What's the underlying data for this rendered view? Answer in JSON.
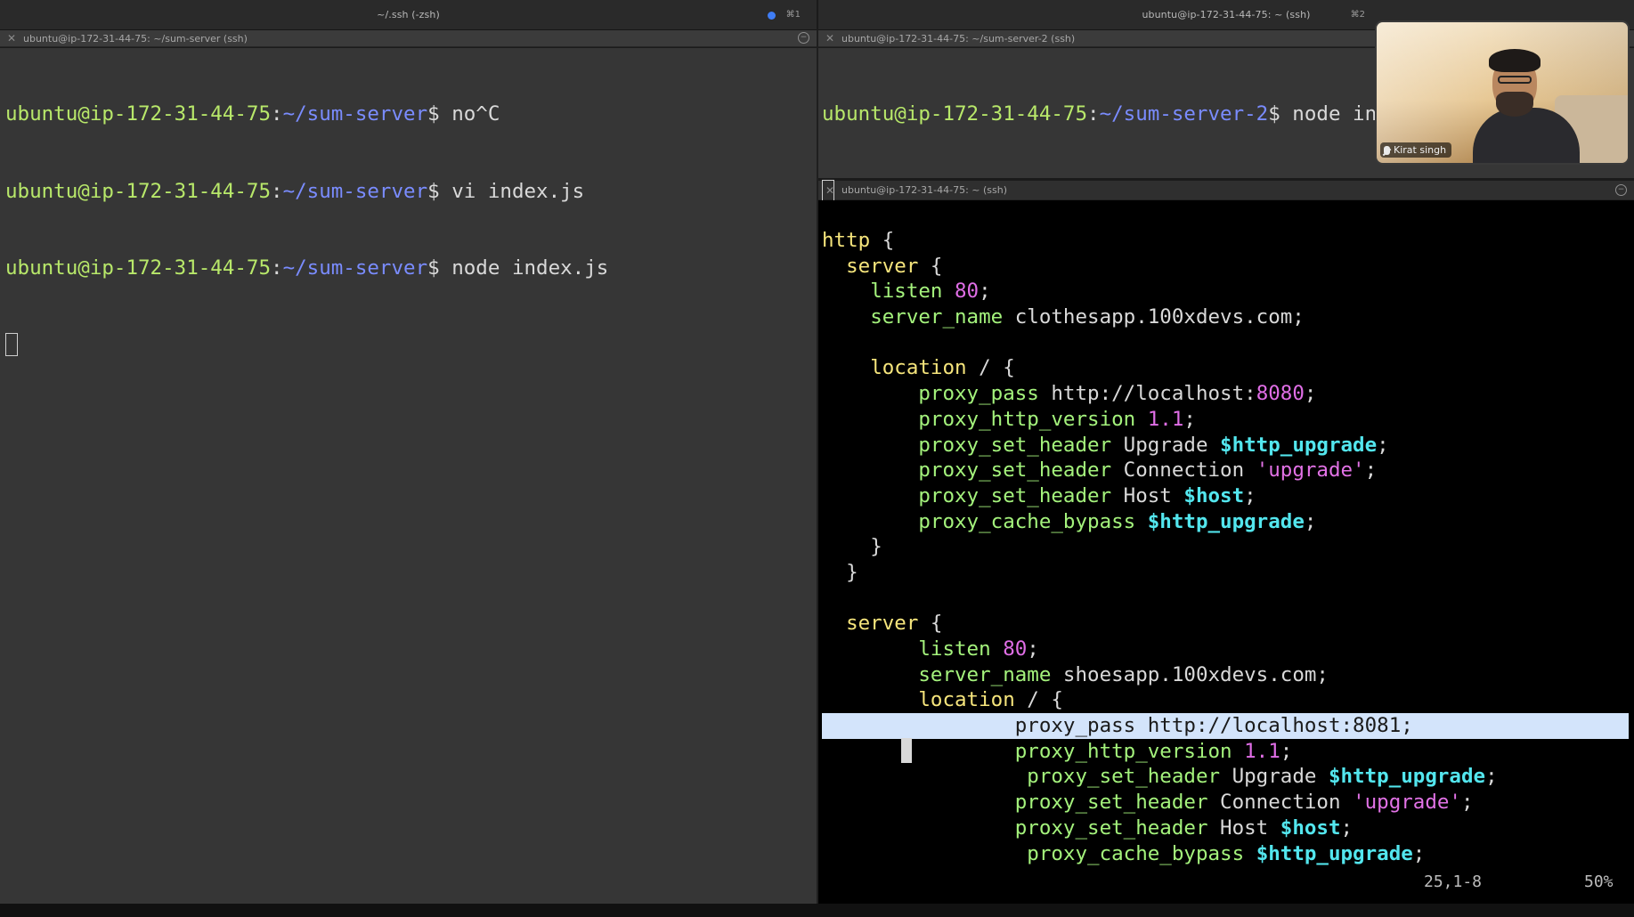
{
  "windows": {
    "left": {
      "title": "~/.ssh (-zsh)",
      "shortcut": "⌘1",
      "has_activity_dot": true
    },
    "right": {
      "title": "ubuntu@ip-172-31-44-75: ~ (ssh)",
      "shortcut": "⌘2"
    }
  },
  "panes": {
    "left": {
      "tab_title": "ubuntu@ip-172-31-44-75: ~/sum-server (ssh)",
      "lines": [
        {
          "user": "ubuntu@ip-172-31-44-75",
          "path": "~/sum-server",
          "cmd": " no^C"
        },
        {
          "user": "ubuntu@ip-172-31-44-75",
          "path": "~/sum-server",
          "cmd": " vi index.js"
        },
        {
          "user": "ubuntu@ip-172-31-44-75",
          "path": "~/sum-server",
          "cmd": " node index.js"
        }
      ]
    },
    "right_top": {
      "tab_title": "ubuntu@ip-172-31-44-75: ~/sum-server-2 (ssh)",
      "lines": [
        {
          "user": "ubuntu@ip-172-31-44-75",
          "path": "~/sum-server-2",
          "cmd": " node index"
        }
      ]
    },
    "right_bottom": {
      "tab_title": "ubuntu@ip-172-31-44-75: ~ (ssh)",
      "editor_lines": [
        {
          "indent": "",
          "tokens": [
            [
              "kw",
              "http"
            ],
            [
              "t",
              " {"
            ]
          ]
        },
        {
          "indent": "  ",
          "tokens": [
            [
              "kw",
              "server"
            ],
            [
              "t",
              " {"
            ]
          ]
        },
        {
          "indent": "    ",
          "tokens": [
            [
              "kn",
              "listen"
            ],
            [
              "t",
              " "
            ],
            [
              "num",
              "80"
            ],
            [
              "t",
              ";"
            ]
          ]
        },
        {
          "indent": "    ",
          "tokens": [
            [
              "kn",
              "server_name"
            ],
            [
              "t",
              " clothesapp.100xdevs.com;"
            ]
          ]
        },
        {
          "indent": "",
          "tokens": []
        },
        {
          "indent": "    ",
          "tokens": [
            [
              "kw",
              "location"
            ],
            [
              "t",
              " / {"
            ]
          ]
        },
        {
          "indent": "        ",
          "tokens": [
            [
              "kn",
              "proxy_pass"
            ],
            [
              "t",
              " http://localhost:"
            ],
            [
              "num",
              "8080"
            ],
            [
              "t",
              ";"
            ]
          ]
        },
        {
          "indent": "        ",
          "tokens": [
            [
              "kn",
              "proxy_http_version"
            ],
            [
              "t",
              " "
            ],
            [
              "num",
              "1.1"
            ],
            [
              "t",
              ";"
            ]
          ]
        },
        {
          "indent": "        ",
          "tokens": [
            [
              "kn",
              "proxy_set_header"
            ],
            [
              "t",
              " Upgrade "
            ],
            [
              "var",
              "$http_upgrade"
            ],
            [
              "t",
              ";"
            ]
          ]
        },
        {
          "indent": "        ",
          "tokens": [
            [
              "kn",
              "proxy_set_header"
            ],
            [
              "t",
              " Connection "
            ],
            [
              "str",
              "'upgrade'"
            ],
            [
              "t",
              ";"
            ]
          ]
        },
        {
          "indent": "        ",
          "tokens": [
            [
              "kn",
              "proxy_set_header"
            ],
            [
              "t",
              " Host "
            ],
            [
              "var",
              "$host"
            ],
            [
              "t",
              ";"
            ]
          ]
        },
        {
          "indent": "        ",
          "tokens": [
            [
              "kn",
              "proxy_cache_bypass"
            ],
            [
              "t",
              " "
            ],
            [
              "var",
              "$http_upgrade"
            ],
            [
              "t",
              ";"
            ]
          ]
        },
        {
          "indent": "    ",
          "tokens": [
            [
              "t",
              "}"
            ]
          ]
        },
        {
          "indent": "  ",
          "tokens": [
            [
              "t",
              "}"
            ]
          ]
        },
        {
          "indent": "",
          "tokens": []
        },
        {
          "indent": "  ",
          "tokens": [
            [
              "kw",
              "server"
            ],
            [
              "t",
              " {"
            ]
          ]
        },
        {
          "indent": "        ",
          "tokens": [
            [
              "kn",
              "listen"
            ],
            [
              "t",
              " "
            ],
            [
              "num",
              "80"
            ],
            [
              "t",
              ";"
            ]
          ]
        },
        {
          "indent": "        ",
          "tokens": [
            [
              "kn",
              "server_name"
            ],
            [
              "t",
              " shoesapp.100xdevs.com;"
            ]
          ]
        },
        {
          "indent": "        ",
          "tokens": [
            [
              "kw",
              "location"
            ],
            [
              "t",
              " / {"
            ]
          ]
        },
        {
          "indent": "                ",
          "tokens": [
            [
              "kn",
              "proxy_pass"
            ],
            [
              "t",
              " http://localhost:8081;"
            ]
          ],
          "selected": true
        },
        {
          "indent": "                ",
          "tokens": [
            [
              "kn",
              "proxy_http_version"
            ],
            [
              "t",
              " "
            ],
            [
              "num",
              "1.1"
            ],
            [
              "t",
              ";"
            ]
          ]
        },
        {
          "indent": "                 ",
          "tokens": [
            [
              "kn",
              "proxy_set_header"
            ],
            [
              "t",
              " Upgrade "
            ],
            [
              "var",
              "$http_upgrade"
            ],
            [
              "t",
              ";"
            ]
          ]
        },
        {
          "indent": "                ",
          "tokens": [
            [
              "kn",
              "proxy_set_header"
            ],
            [
              "t",
              " Connection "
            ],
            [
              "str",
              "'upgrade'"
            ],
            [
              "t",
              ";"
            ]
          ]
        },
        {
          "indent": "                ",
          "tokens": [
            [
              "kn",
              "proxy_set_header"
            ],
            [
              "t",
              " Host "
            ],
            [
              "var",
              "$host"
            ],
            [
              "t",
              ";"
            ]
          ]
        },
        {
          "indent": "                 ",
          "tokens": [
            [
              "kn",
              "proxy_cache_bypass"
            ],
            [
              "t",
              " "
            ],
            [
              "var",
              "$http_upgrade"
            ],
            [
              "t",
              ";"
            ]
          ]
        }
      ],
      "status": {
        "position": "25,1-8",
        "percent": "50%"
      }
    }
  },
  "video_call": {
    "participant_name": "Kirat singh",
    "mic_icon": "microphone-icon"
  },
  "colors": {
    "prompt_user": "#b8e86a",
    "prompt_path": "#7a8cff",
    "keyword_block": "#f6e57c",
    "keyword_directive": "#a4f27c",
    "number": "#e06ee6",
    "variable": "#53e6ee",
    "selection": "#d3e4fb"
  }
}
